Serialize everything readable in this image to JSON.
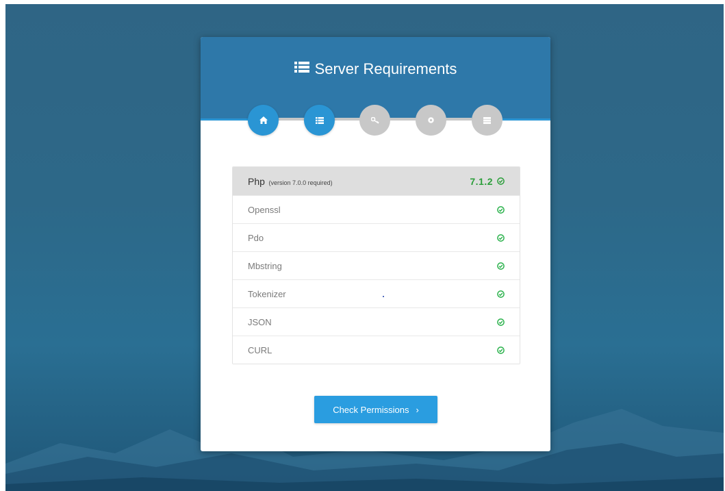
{
  "page": {
    "title": "Server Requirements"
  },
  "steps": [
    {
      "icon": "home-icon",
      "state": "complete"
    },
    {
      "icon": "list-icon",
      "state": "current"
    },
    {
      "icon": "key-icon",
      "state": "pending"
    },
    {
      "icon": "cog-icon",
      "state": "pending"
    },
    {
      "icon": "server-icon",
      "state": "pending"
    }
  ],
  "requirements": {
    "header": {
      "name": "Php",
      "note": "(version 7.0.0 required)",
      "version": "7.1.2",
      "status": "ok"
    },
    "items": [
      {
        "name": "Openssl",
        "status": "ok"
      },
      {
        "name": "Pdo",
        "status": "ok"
      },
      {
        "name": "Mbstring",
        "status": "ok"
      },
      {
        "name": "Tokenizer",
        "status": "ok"
      },
      {
        "name": "JSON",
        "status": "ok"
      },
      {
        "name": "CURL",
        "status": "ok"
      }
    ]
  },
  "actions": {
    "next_label": "Check Permissions",
    "next_chevron": "›"
  },
  "colors": {
    "header": "#2e78a9",
    "accent": "#2a95d4",
    "inactive": "#c8c8c8",
    "success": "#2b9e3a",
    "button": "#2a9de0"
  }
}
